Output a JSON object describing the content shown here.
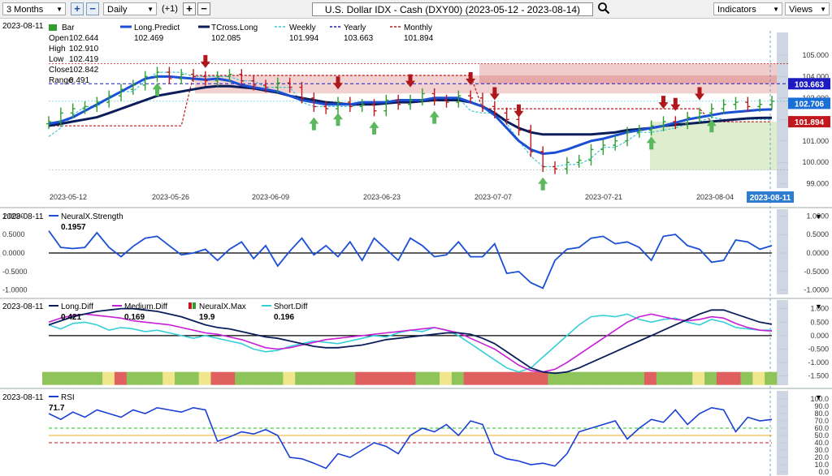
{
  "toolbar": {
    "range_select": "3 Months",
    "interval_select": "Daily",
    "offset_label": "(+1)",
    "plus_symbol": "+",
    "minus_symbol": "−",
    "title": "U.S. Dollar IDX - Cash (DXY00) (2023-05-12 - 2023-08-14)",
    "indicators_label": "Indicators",
    "views_label": "Views"
  },
  "colors": {
    "long_predict": "#1a4fd6",
    "tcross_long": "#0b1e5a",
    "weekly": "#3fc7d6",
    "yearly": "#1c1cc0",
    "monthly": "#c0181c",
    "up_bar": "#2e9e2e",
    "down_bar": "#c0181c",
    "long_diff": "#0b1e5a",
    "medium_diff": "#c81ed8",
    "short_diff": "#36cfd8",
    "rsi": "#1a3fd6",
    "neural_max_up": "#8fc45a",
    "neural_max_down": "#e06060",
    "neural_max_neutral": "#f0e68c"
  },
  "chart_data": [
    {
      "type": "line",
      "name_label": "main",
      "date_label": "2023-08-11",
      "legend": {
        "bar": "Bar",
        "long_predict": {
          "name": "Long.Predict",
          "value": "102.469"
        },
        "tcross_long": {
          "name": "TCross.Long",
          "value": "102.085"
        },
        "weekly": {
          "name": "Weekly",
          "value": "101.994"
        },
        "yearly": {
          "name": "Yearly",
          "value": "103.663"
        },
        "monthly": {
          "name": "Monthly",
          "value": "101.894"
        }
      },
      "ohlc_panel": {
        "open_label": "Open",
        "open": "102.644",
        "high_label": "High",
        "high": "102.910",
        "low_label": "Low",
        "low": "102.419",
        "close_label": "Close",
        "close": "102.842",
        "range_label": "Range",
        "range": "0.491"
      },
      "x_labels": [
        "2023-05-12",
        "2023-05-26",
        "2023-06-09",
        "2023-06-23",
        "2023-07-07",
        "2023-07-21",
        "2023-08-04"
      ],
      "current_date_badge": "2023-08-11",
      "y_ticks": [
        "105.000",
        "104.000",
        "103.000",
        "102.000",
        "101.000",
        "100.000",
        "99.000"
      ],
      "ylim": [
        98.8,
        105.6
      ],
      "price_badges": {
        "yearly": "103.663",
        "close": "102.706",
        "monthly": "101.894"
      },
      "closes": [
        101.9,
        102.3,
        102.5,
        102.6,
        102.8,
        103.1,
        103.4,
        103.6,
        104.0,
        104.2,
        103.9,
        104.1,
        104.0,
        103.8,
        104.0,
        104.1,
        103.8,
        103.6,
        103.5,
        103.7,
        103.5,
        103.0,
        102.6,
        102.5,
        102.8,
        102.6,
        102.7,
        102.4,
        102.9,
        102.7,
        102.9,
        103.2,
        102.9,
        102.8,
        103.1,
        103.0,
        102.6,
        102.3,
        102.0,
        101.5,
        100.5,
        99.8,
        99.7,
        100.0,
        100.1,
        100.6,
        100.8,
        101.0,
        101.4,
        101.5,
        101.7,
        101.9,
        101.8,
        102.1,
        102.3,
        102.5,
        102.7,
        102.8,
        102.6,
        102.7,
        102.85
      ],
      "long_predict": [
        101.8,
        101.9,
        102.1,
        102.4,
        102.7,
        103.0,
        103.3,
        103.6,
        103.9,
        104.0,
        104.0,
        103.95,
        103.9,
        103.85,
        103.9,
        103.8,
        103.6,
        103.5,
        103.4,
        103.3,
        103.1,
        102.9,
        102.8,
        102.7,
        102.7,
        102.7,
        102.8,
        102.8,
        102.8,
        102.9,
        102.9,
        102.9,
        103.0,
        103.0,
        103.0,
        102.8,
        102.6,
        102.2,
        101.6,
        101.0,
        100.6,
        100.4,
        100.45,
        100.6,
        100.8,
        101.0,
        101.1,
        101.25,
        101.4,
        101.5,
        101.6,
        101.7,
        101.85,
        102.0,
        102.1,
        102.2,
        102.3,
        102.35,
        102.4,
        102.45,
        102.47
      ],
      "tcross_long": [
        101.7,
        101.8,
        101.9,
        102.0,
        102.1,
        102.3,
        102.5,
        102.7,
        102.9,
        103.1,
        103.2,
        103.3,
        103.4,
        103.5,
        103.55,
        103.55,
        103.5,
        103.45,
        103.35,
        103.25,
        103.1,
        103.0,
        102.9,
        102.8,
        102.75,
        102.7,
        102.7,
        102.7,
        102.75,
        102.8,
        102.8,
        102.85,
        102.9,
        102.9,
        102.9,
        102.8,
        102.6,
        102.3,
        101.9,
        101.6,
        101.4,
        101.3,
        101.3,
        101.3,
        101.3,
        101.3,
        101.35,
        101.4,
        101.5,
        101.55,
        101.6,
        101.7,
        101.75,
        101.8,
        101.85,
        101.9,
        101.95,
        102.0,
        102.05,
        102.07,
        102.08
      ],
      "weekly": [
        101.2,
        101.6,
        102.2,
        102.6,
        102.6,
        103.0,
        103.3,
        103.3,
        103.8,
        104.2,
        104.2,
        104.2,
        104.0,
        104.0,
        104.0,
        104.0,
        103.8,
        103.8,
        103.5,
        103.5,
        103.5,
        102.8,
        102.6,
        102.6,
        102.6,
        102.6,
        102.7,
        102.7,
        102.7,
        102.9,
        102.9,
        102.9,
        103.0,
        103.0,
        103.0,
        102.4,
        102.3,
        102.3,
        101.8,
        101.0,
        100.3,
        99.8,
        99.8,
        99.9,
        99.9,
        100.2,
        100.7,
        100.7,
        101.0,
        101.4,
        101.4,
        101.5,
        101.6,
        101.8,
        101.9,
        102.1,
        102.0,
        102.0,
        102.0,
        102.0,
        101.99
      ],
      "yearly_level": 103.663,
      "monthly": [
        101.7,
        101.7,
        101.7,
        101.7,
        101.7,
        101.7,
        101.7,
        101.7,
        101.7,
        101.7,
        101.7,
        101.7,
        104.05,
        104.05,
        104.05,
        104.05,
        104.05,
        104.05,
        104.05,
        104.05,
        104.05,
        104.05,
        104.05,
        104.05,
        104.05,
        104.05,
        104.05,
        104.05,
        104.05,
        104.05,
        104.05,
        104.05,
        104.05,
        104.05,
        104.05,
        104.05,
        102.5,
        102.5,
        102.5,
        102.5,
        102.5,
        102.5,
        102.5,
        102.5,
        102.5,
        102.5,
        102.5,
        102.5,
        102.5,
        102.5,
        102.5,
        102.5,
        102.5,
        102.5,
        102.5,
        101.89,
        101.89,
        101.89,
        101.89,
        101.89,
        101.89
      ],
      "up_arrows": [
        9,
        22,
        24,
        27,
        32,
        41,
        50,
        55
      ],
      "down_arrows": [
        13,
        24,
        30,
        35,
        37,
        39,
        51,
        52,
        54
      ]
    },
    {
      "type": "line",
      "name_label": "neuralx-strength",
      "date_label": "2023-08-11",
      "series": [
        {
          "name": "NeuralX.Strength",
          "value": "0.1957"
        }
      ],
      "y_ticks": [
        "1.0000",
        "0.5000",
        "0.0000",
        "-0.5000",
        "-1.0000"
      ],
      "ylim": [
        -1.05,
        1.05
      ],
      "values": [
        0.6,
        0.15,
        0.12,
        0.15,
        0.55,
        0.15,
        -0.1,
        0.18,
        0.4,
        0.45,
        0.2,
        -0.05,
        0.0,
        0.1,
        -0.2,
        0.1,
        0.3,
        -0.15,
        0.2,
        -0.35,
        0.05,
        0.4,
        -0.05,
        0.2,
        -0.1,
        0.3,
        -0.2,
        0.4,
        0.1,
        -0.2,
        0.4,
        0.2,
        -0.1,
        -0.05,
        0.3,
        -0.1,
        -0.1,
        0.25,
        -0.55,
        -0.5,
        -0.8,
        -0.95,
        -0.2,
        0.1,
        0.15,
        0.4,
        0.45,
        0.25,
        0.3,
        0.15,
        -0.2,
        0.45,
        0.5,
        0.2,
        0.1,
        -0.25,
        -0.2,
        0.35,
        0.3,
        0.1,
        0.2
      ]
    },
    {
      "type": "line",
      "name_label": "diffs",
      "date_label": "2023-08-11",
      "series": [
        {
          "name": "Long.Diff",
          "value": "0.421"
        },
        {
          "name": "Medium.Diff",
          "value": "0.169"
        },
        {
          "name": "NeuralX.Max",
          "value": "19.9"
        },
        {
          "name": "Short.Diff",
          "value": "0.196"
        }
      ],
      "y_ticks": [
        "1.000",
        "0.500",
        "0.000",
        "-0.500",
        "-1.000",
        "-1.500"
      ],
      "ylim": [
        -1.6,
        1.2
      ],
      "long_diff": [
        0.4,
        0.55,
        0.7,
        0.8,
        0.9,
        0.95,
        1.0,
        1.0,
        0.95,
        0.9,
        0.8,
        0.7,
        0.55,
        0.4,
        0.3,
        0.25,
        0.15,
        0.05,
        -0.05,
        -0.1,
        -0.2,
        -0.3,
        -0.4,
        -0.45,
        -0.45,
        -0.4,
        -0.35,
        -0.25,
        -0.15,
        -0.1,
        -0.05,
        0.0,
        0.05,
        0.1,
        0.1,
        0.05,
        -0.1,
        -0.3,
        -0.6,
        -0.9,
        -1.2,
        -1.35,
        -1.4,
        -1.35,
        -1.2,
        -1.0,
        -0.8,
        -0.6,
        -0.4,
        -0.2,
        0.0,
        0.2,
        0.4,
        0.6,
        0.8,
        0.95,
        0.95,
        0.8,
        0.65,
        0.5,
        0.42
      ],
      "medium_diff": [
        0.5,
        0.65,
        0.75,
        0.8,
        0.75,
        0.7,
        0.65,
        0.55,
        0.5,
        0.45,
        0.4,
        0.3,
        0.2,
        0.1,
        0.05,
        -0.05,
        -0.15,
        -0.3,
        -0.45,
        -0.5,
        -0.45,
        -0.35,
        -0.25,
        -0.15,
        -0.1,
        -0.05,
        0.0,
        0.05,
        0.1,
        0.15,
        0.2,
        0.25,
        0.3,
        0.2,
        0.1,
        -0.1,
        -0.3,
        -0.5,
        -0.8,
        -1.1,
        -1.3,
        -1.35,
        -1.25,
        -1.0,
        -0.7,
        -0.4,
        -0.1,
        0.2,
        0.5,
        0.7,
        0.8,
        0.7,
        0.6,
        0.55,
        0.6,
        0.7,
        0.65,
        0.45,
        0.3,
        0.2,
        0.17
      ],
      "short_diff": [
        0.4,
        0.25,
        0.45,
        0.5,
        0.4,
        0.2,
        0.3,
        0.25,
        0.15,
        0.2,
        0.1,
        0.0,
        -0.1,
        0.0,
        -0.1,
        -0.2,
        -0.3,
        -0.5,
        -0.6,
        -0.55,
        -0.4,
        -0.3,
        -0.2,
        -0.25,
        -0.3,
        -0.2,
        -0.1,
        0.0,
        -0.05,
        0.1,
        0.2,
        0.15,
        0.3,
        0.2,
        0.0,
        -0.3,
        -0.6,
        -0.9,
        -1.2,
        -1.35,
        -1.2,
        -0.8,
        -0.4,
        0.0,
        0.4,
        0.7,
        0.75,
        0.7,
        0.8,
        0.6,
        0.5,
        0.6,
        0.65,
        0.5,
        0.4,
        0.6,
        0.5,
        0.3,
        0.25,
        0.2,
        0.2
      ],
      "neural_max_colors": [
        "up",
        "up",
        "up",
        "up",
        "up",
        "neutral",
        "down",
        "up",
        "up",
        "up",
        "neutral",
        "up",
        "up",
        "neutral",
        "down",
        "down",
        "up",
        "up",
        "up",
        "up",
        "neutral",
        "up",
        "up",
        "up",
        "up",
        "up",
        "down",
        "down",
        "down",
        "down",
        "down",
        "up",
        "up",
        "neutral",
        "up",
        "down",
        "down",
        "down",
        "down",
        "down",
        "down",
        "down",
        "up",
        "up",
        "up",
        "up",
        "up",
        "up",
        "up",
        "up",
        "down",
        "up",
        "up",
        "up",
        "neutral",
        "up",
        "down",
        "down",
        "up",
        "neutral",
        "up"
      ]
    },
    {
      "type": "line",
      "name_label": "rsi",
      "date_label": "2023-08-11",
      "series": [
        {
          "name": "RSI",
          "value": "71.7"
        }
      ],
      "y_ticks": [
        "100.0",
        "90.0",
        "80.0",
        "70.0",
        "60.0",
        "50.0",
        "40.0",
        "30.0",
        "20.0",
        "10.0",
        "0.0"
      ],
      "ylim": [
        0,
        100
      ],
      "reference_lines": [
        60,
        50,
        40
      ],
      "values": [
        80,
        72,
        82,
        75,
        85,
        80,
        75,
        85,
        80,
        88,
        85,
        82,
        88,
        85,
        42,
        48,
        55,
        52,
        58,
        50,
        20,
        18,
        12,
        5,
        25,
        20,
        30,
        40,
        35,
        25,
        50,
        60,
        55,
        65,
        50,
        70,
        65,
        25,
        18,
        15,
        10,
        12,
        8,
        25,
        55,
        60,
        65,
        70,
        45,
        60,
        72,
        68,
        85,
        65,
        80,
        88,
        85,
        55,
        75,
        70,
        72
      ]
    }
  ]
}
